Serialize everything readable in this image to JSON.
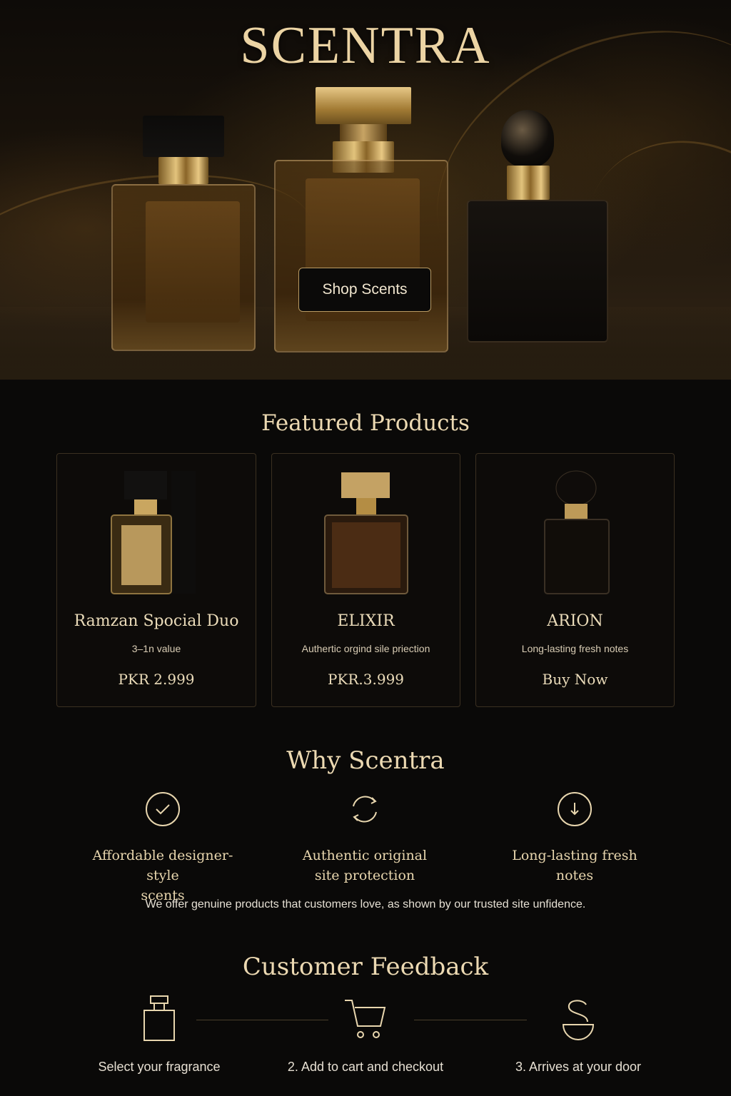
{
  "brand": {
    "name": "SCENTRA"
  },
  "hero": {
    "cta_label": "Shop Scents"
  },
  "featured": {
    "title": "Featured Products",
    "products": [
      {
        "name": "Ramzan Spocial Duo",
        "description": "3–1n value",
        "price": "PKR 2.999"
      },
      {
        "name": "ELIXIR",
        "description": "Authertic orgind sile priection",
        "price": "PKR.3.999"
      },
      {
        "name": "ARION",
        "description": "Long-lasting fresh notes",
        "price": "Buy Now"
      }
    ]
  },
  "why": {
    "title": "Why Scentra",
    "features": [
      {
        "icon": "check-circle-icon",
        "line1": "Affordable designer-style",
        "line2": "scents"
      },
      {
        "icon": "refresh-icon",
        "line1": "Authentic original",
        "line2": "site protection"
      },
      {
        "icon": "download-circle-icon",
        "line1": "Long-lasting fresh notes",
        "line2": ""
      }
    ],
    "note": "We offer genuine products that customers love, as shown by our trusted site unfidence."
  },
  "feedback": {
    "title": "Customer Feedback",
    "steps": [
      {
        "icon": "perfume-bottle-icon",
        "label": "Select your fragrance"
      },
      {
        "icon": "cart-icon",
        "label": "2. Add to cart and checkout"
      },
      {
        "icon": "delivery-s-icon",
        "label": "3. Arrives at your door"
      }
    ]
  },
  "colors": {
    "background": "#0a0908",
    "accent_gold": "#e8d6ae",
    "card_border": "#3b3021"
  }
}
